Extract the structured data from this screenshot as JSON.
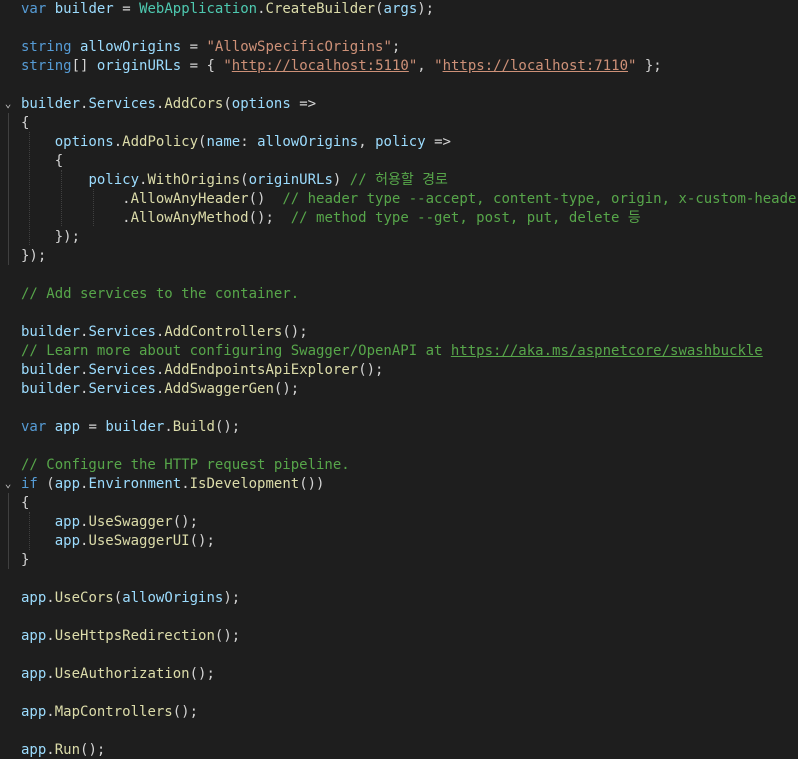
{
  "code_lines": [
    "var builder = WebApplication.CreateBuilder(args);",
    "",
    "string allowOrigins = \"AllowSpecificOrigins\";",
    "string[] originURLs = { \"http://localhost:5110\", \"https://localhost:7110\" };",
    "",
    "builder.Services.AddCors(options =>",
    "{",
    "    options.AddPolicy(name: allowOrigins, policy =>",
    "    {",
    "        policy.WithOrigins(originURLs) // 허용할 경로",
    "            .AllowAnyHeader()  // header type --accept, content-type, origin, x-custom-header 등",
    "            .AllowAnyMethod();  // method type --get, post, put, delete 등",
    "    });",
    "});",
    "",
    "// Add services to the container.",
    "",
    "builder.Services.AddControllers();",
    "// Learn more about configuring Swagger/OpenAPI at https://aka.ms/aspnetcore/swashbuckle",
    "builder.Services.AddEndpointsApiExplorer();",
    "builder.Services.AddSwaggerGen();",
    "",
    "var app = builder.Build();",
    "",
    "// Configure the HTTP request pipeline.",
    "if (app.Environment.IsDevelopment())",
    "{",
    "    app.UseSwagger();",
    "    app.UseSwaggerUI();",
    "}",
    "",
    "app.UseCors(allowOrigins);",
    "",
    "app.UseHttpsRedirection();",
    "",
    "app.UseAuthorization();",
    "",
    "app.MapControllers();",
    "",
    "app.Run();"
  ],
  "strings": {
    "allow_origins_value": "\"AllowSpecificOrigins\"",
    "url_http": "http://localhost:5110",
    "url_https": "https://localhost:7110",
    "comment_paths": "// 허용할 경로",
    "comment_header": "// header type --accept, content-type, origin, x-custom-header 등",
    "comment_method": "// method type --get, post, put, delete 등",
    "comment_add_services": "// Add services to the container.",
    "comment_learn_more": "// Learn more about configuring Swagger/OpenAPI at ",
    "url_swashbuckle": "https://aka.ms/aspnetcore/swashbuckle",
    "comment_configure": "// Configure the HTTP request pipeline."
  },
  "fold_markers": [
    {
      "line": 6,
      "symbol": "⌄"
    },
    {
      "line": 26,
      "symbol": "⌄"
    }
  ],
  "colors": {
    "background": "#1e1e1e",
    "keyword": "#569cd6",
    "string": "#ce9178",
    "comment": "#57a64a",
    "method": "#dcdcaa",
    "type": "#4ec9b0",
    "identifier": "#9cdcfe",
    "plain": "#d4d4d4"
  }
}
